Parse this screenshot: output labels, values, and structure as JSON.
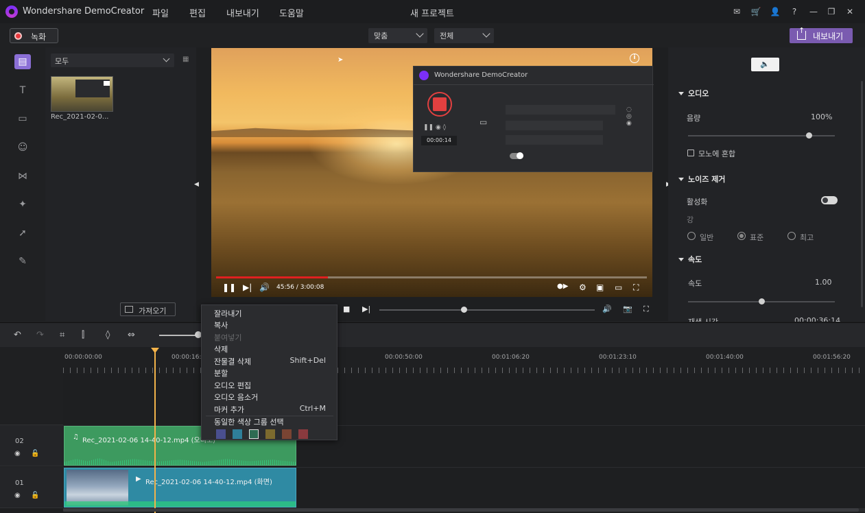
{
  "titlebar": {
    "app_name": "Wondershare DemoCreator",
    "menu": [
      "파일",
      "편집",
      "내보내기",
      "도움말"
    ],
    "window_title": "새 프로젝트"
  },
  "toolbar": {
    "record_label": "녹화",
    "fit_select": "맞춤",
    "quality_select": "전체",
    "export_label": "내보내기"
  },
  "library": {
    "filter_select": "모두",
    "clip_name": "Rec_2021-02-0...",
    "import_label": "가져오기"
  },
  "preview": {
    "recorder_window_title": "Wondershare DemoCreator",
    "recorder_time": "00:00:14",
    "video_time": "45:56 / 3:00:08",
    "progress": 0.26
  },
  "right_panel": {
    "audio_section": "오디오",
    "volume_label": "음량",
    "volume_value": "100%",
    "mono_label": "모노에 혼합",
    "denoise_section": "노이즈 제거",
    "enable_label": "활성화",
    "level_label": "강",
    "radio_options": [
      "일반",
      "표준",
      "최고"
    ],
    "speed_section": "속도",
    "speed_label": "속도",
    "speed_value": "1.00",
    "duration_label": "재생 시간",
    "duration_value": "00:00:36:14"
  },
  "timeline": {
    "ticks": [
      "00:00:00:00",
      "00:00:16:20",
      "00:00:50:00",
      "00:01:06:20",
      "00:01:23:10",
      "00:01:40:00",
      "00:01:56:20"
    ],
    "tracks": [
      {
        "num": "02",
        "clip_label": "Rec_2021-02-06 14-40-12.mp4 (오디오)"
      },
      {
        "num": "01",
        "clip_label": "Rec_2021-02-06 14-40-12.mp4 (화면)"
      }
    ]
  },
  "context_menu": {
    "items": [
      {
        "label": "잘라내기",
        "shortcut": ""
      },
      {
        "label": "복사",
        "shortcut": ""
      },
      {
        "label": "붙여넣기",
        "shortcut": ""
      },
      {
        "label": "삭제",
        "shortcut": ""
      },
      {
        "label": "잔물결 삭제",
        "shortcut": "Shift+Del"
      },
      {
        "label": "분할",
        "shortcut": ""
      },
      {
        "label": "오디오 편집",
        "shortcut": ""
      },
      {
        "label": "오디오 음소거",
        "shortcut": ""
      },
      {
        "label": "마커 추가",
        "shortcut": "Ctrl+M"
      },
      {
        "label": "동일한 색상 그룹 선택",
        "shortcut": ""
      }
    ],
    "swatch_colors": [
      "#4a4f8f",
      "#2f7f9a",
      "#2d6b52",
      "#7d6a2e",
      "#7a4433",
      "#8a3a3e"
    ]
  },
  "colors": {
    "accent": "#8b6fd6",
    "export": "#7a5bb0",
    "record": "#e8383d",
    "playhead": "#f3b34a"
  }
}
